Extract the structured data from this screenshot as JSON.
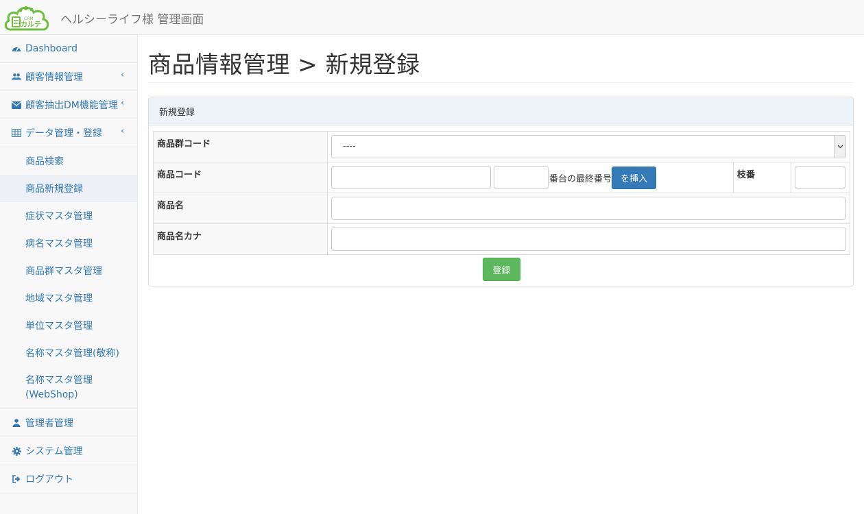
{
  "header": {
    "logo_text_top": "CRM",
    "logo_text_main": "カルテ",
    "brand": "ヘルシーライフ様 管理画面"
  },
  "sidebar": {
    "dashboard": "Dashboard",
    "customer_info": "顧客情報管理",
    "customer_dm": "顧客抽出DM機能管理",
    "data_mgmt": "データ管理・登録",
    "sub_items": [
      "商品検索",
      "商品新規登録",
      "症状マスタ管理",
      "病名マスタ管理",
      "商品群マスタ管理",
      "地域マスタ管理",
      "単位マスタ管理",
      "名称マスタ管理(敬称)",
      "名称マスタ管理(WebShop)"
    ],
    "admin": "管理者管理",
    "system": "システム管理",
    "logout": "ログアウト",
    "chevron": "‹"
  },
  "main": {
    "title": "商品情報管理 > 新規登録",
    "panel_heading": "新規登録",
    "form": {
      "group_code_label": "商品群コード",
      "group_code_value": "----",
      "product_code_label": "商品コード",
      "product_code_note": "番台の最終番号",
      "insert_button": "を挿入",
      "branch_label": "枝番",
      "product_name_label": "商品名",
      "product_kana_label": "商品名カナ",
      "submit_button": "登録"
    }
  },
  "colors": {
    "link": "#337ab7",
    "primary_button": "#337ab7",
    "success_button": "#5cb85c",
    "logo_green": "#6bbf3a"
  }
}
